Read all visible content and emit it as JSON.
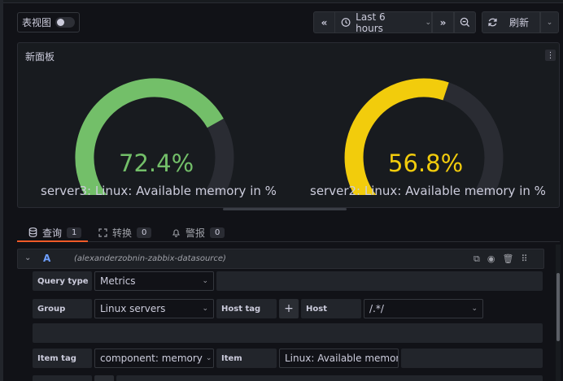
{
  "toolbar": {
    "table_view_label": "表视图",
    "time_range_label": "Last 6 hours",
    "refresh_label": "刷新"
  },
  "panel": {
    "title": "新面板",
    "gauges": [
      {
        "label": "server3: Linux: Available memory in %",
        "value": "72.4%",
        "fraction": 0.724,
        "color": "#73bf69"
      },
      {
        "label": "server2: Linux: Available memory in %",
        "value": "56.8%",
        "fraction": 0.568,
        "color": "#f2cc0c"
      }
    ]
  },
  "tabs": [
    {
      "label": "查询",
      "count": "1"
    },
    {
      "label": "转换",
      "count": "0"
    },
    {
      "label": "警报",
      "count": "0"
    }
  ],
  "query": {
    "ref_id": "A",
    "datasource": "(alexanderzobnin-zabbix-datasource)",
    "query_type_label": "Query type",
    "query_type_value": "Metrics",
    "group_label": "Group",
    "group_value": "Linux servers",
    "host_tag_label": "Host tag",
    "add_label": "+",
    "host_label": "Host",
    "host_value": "/.*/",
    "item_tag_label": "Item tag",
    "item_tag_value": "component: memory",
    "item_label": "Item",
    "item_value": "Linux: Available memor"
  },
  "icons": {
    "prev": "chevron-double-left-icon",
    "clock": "clock-icon",
    "next": "chevron-double-right-icon",
    "zoom": "zoom-out-icon",
    "refresh": "sync-icon"
  }
}
